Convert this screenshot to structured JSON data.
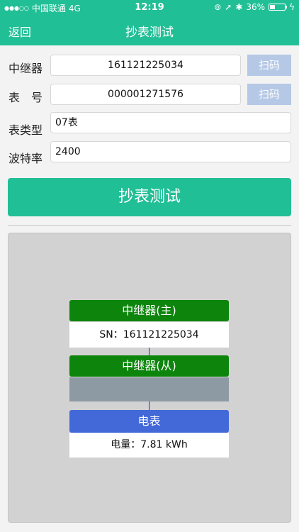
{
  "status_bar": {
    "carrier": "中国联通",
    "network": "4G",
    "time": "12:19",
    "battery_percent": "36%",
    "battery_level": 0.36
  },
  "nav": {
    "back_label": "返回",
    "title": "抄表测试"
  },
  "form": {
    "repeater": {
      "label": "中继器",
      "value": "161121225034",
      "scan_label": "扫码"
    },
    "meter_no": {
      "label": "表　号",
      "value": "000001271576",
      "scan_label": "扫码"
    },
    "meter_type": {
      "label": "表类型",
      "value": "07表"
    },
    "baud_rate": {
      "label": "波特率",
      "value": "2400"
    }
  },
  "test_button_label": "抄表测试",
  "diagram": {
    "master": {
      "title": "中继器(主)",
      "info": "SN：161121225034"
    },
    "slave": {
      "title": "中继器(从)"
    },
    "meter": {
      "title": "电表",
      "info": "电量：7.81 kWh"
    }
  },
  "colors": {
    "accent": "#21bf96",
    "scan_button": "#b5c8e6",
    "repeater_node": "#0d850c",
    "meter_node": "#4369d9",
    "empty_node": "#8e9aa3"
  }
}
